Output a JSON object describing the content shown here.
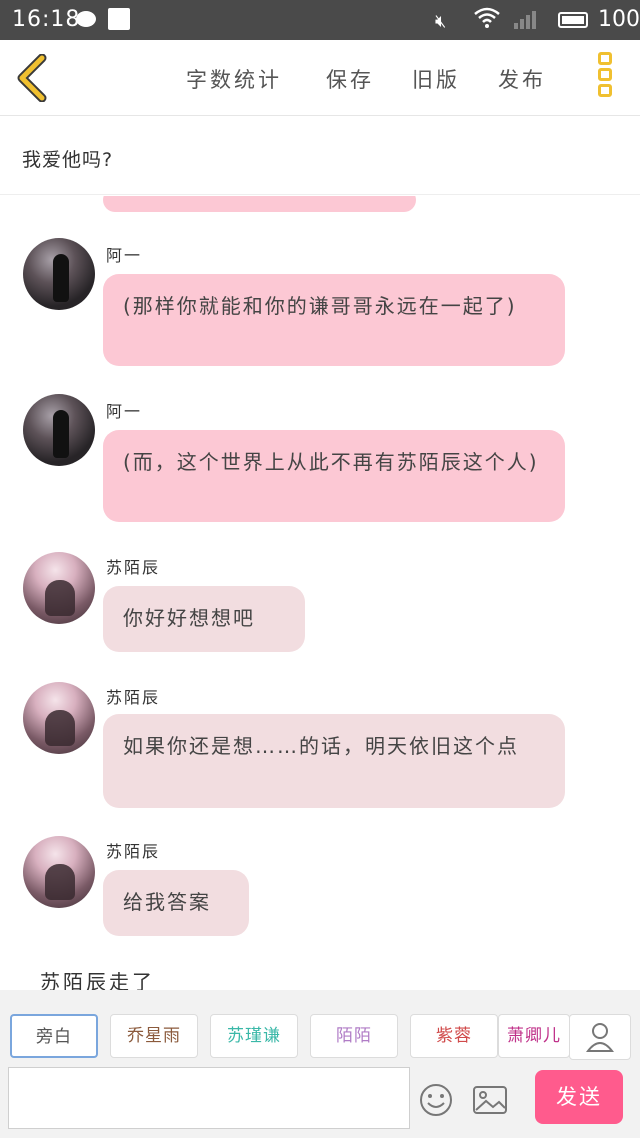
{
  "status_bar": {
    "time": "16:18",
    "battery": "100"
  },
  "toolbar": {
    "word_count": "字数统计",
    "save": "保存",
    "old_version": "旧版",
    "publish": "发布"
  },
  "chapter_title": "我爱他吗?",
  "messages": [
    {
      "sender": "阿一",
      "text": "(那样你就能和你的谦哥哥永远在一起了)",
      "avatar": "dark",
      "color": "#fcc8d4"
    },
    {
      "sender": "阿一",
      "text": "(而，这个世界上从此不再有苏陌辰这个人)",
      "avatar": "dark",
      "color": "#fcc8d4"
    },
    {
      "sender": "苏陌辰",
      "text": "你好好想想吧",
      "avatar": "pink",
      "color": "#f2dde0"
    },
    {
      "sender": "苏陌辰",
      "text": "如果你还是想……的话，明天依旧这个点",
      "avatar": "pink",
      "color": "#f2dde0"
    },
    {
      "sender": "苏陌辰",
      "text": "给我答案",
      "avatar": "pink",
      "color": "#f2dde0"
    }
  ],
  "narration": "苏陌辰走了",
  "role_tabs": [
    {
      "label": "旁白",
      "color": "#555555"
    },
    {
      "label": "乔星雨",
      "color": "#8b5a3c"
    },
    {
      "label": "苏瑾谦",
      "color": "#3ab8a8"
    },
    {
      "label": "陌陌",
      "color": "#b07cc6"
    },
    {
      "label": "紫蓉",
      "color": "#d04a4a"
    },
    {
      "label": "萧卿儿",
      "color": "#c0328a"
    }
  ],
  "input": {
    "value": "",
    "send_label": "发送"
  }
}
